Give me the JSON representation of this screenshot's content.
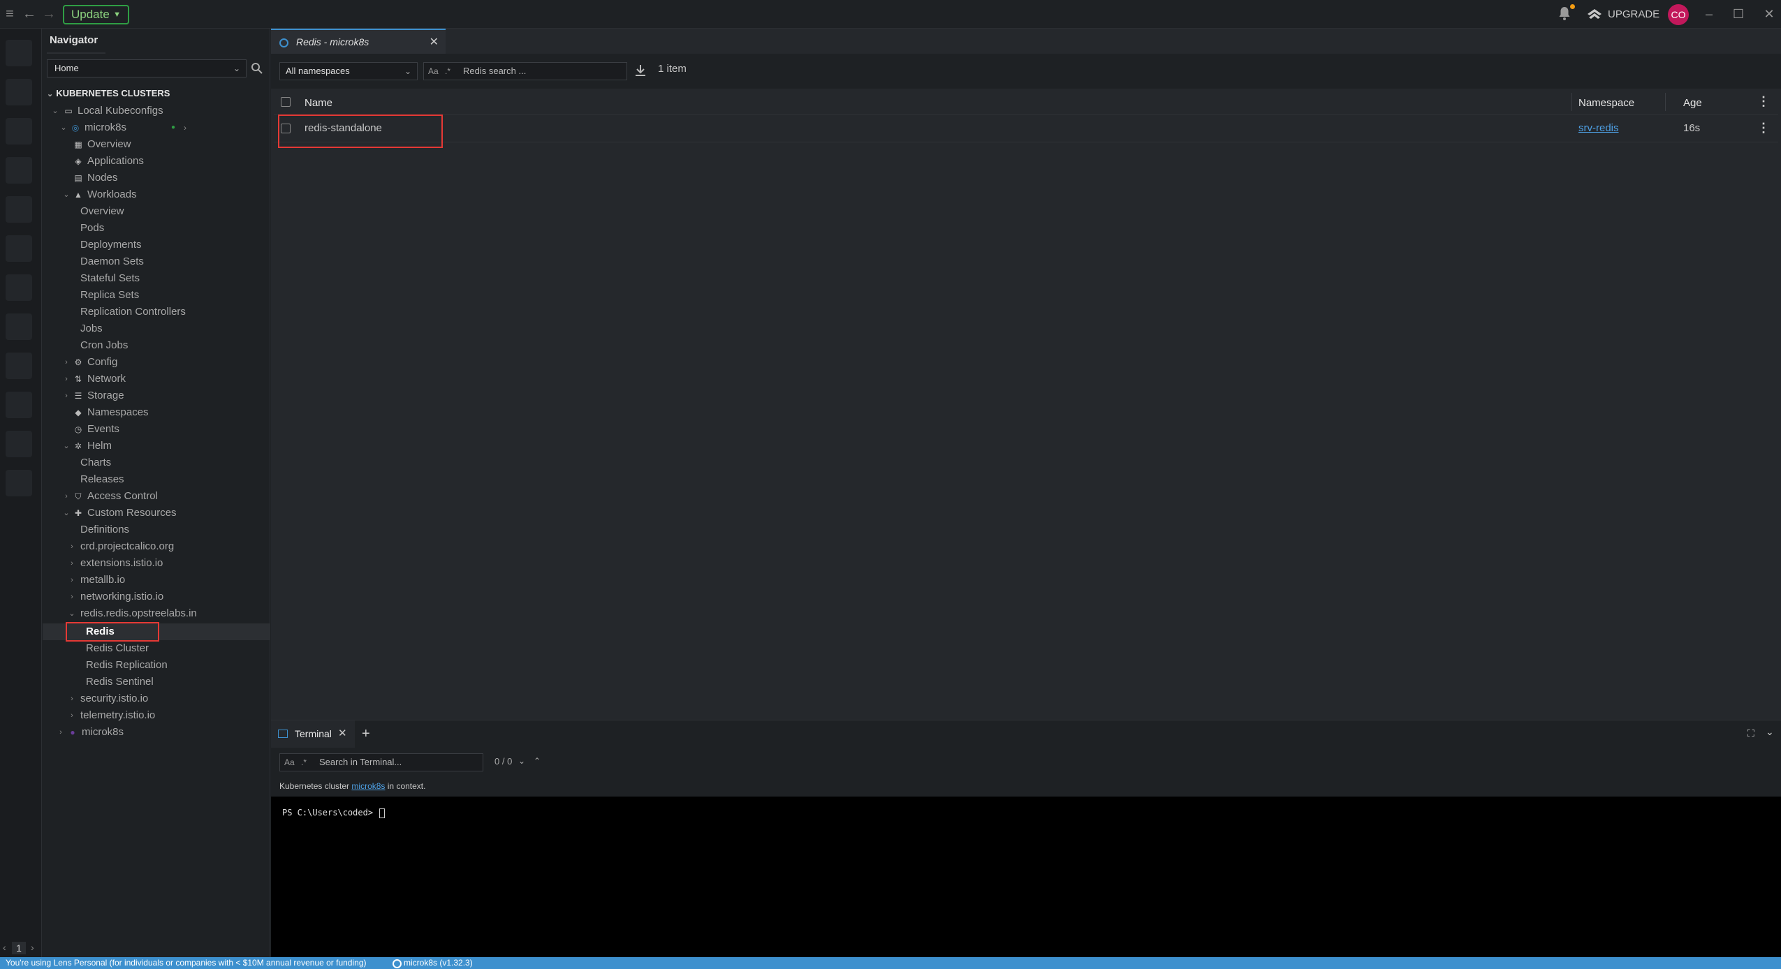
{
  "topbar": {
    "update_label": "Update",
    "upgrade_label": "UPGRADE",
    "avatar_initials": "CO"
  },
  "hotbar": {
    "page": "1"
  },
  "navigator": {
    "title": "Navigator",
    "context_select": "Home",
    "section_header": "KUBERNETES CLUSTERS",
    "items": [
      {
        "label": "Local Kubeconfigs"
      },
      {
        "label": "microk8s"
      },
      {
        "label": "Overview"
      },
      {
        "label": "Applications"
      },
      {
        "label": "Nodes"
      },
      {
        "label": "Workloads"
      },
      {
        "label": "Overview"
      },
      {
        "label": "Pods"
      },
      {
        "label": "Deployments"
      },
      {
        "label": "Daemon Sets"
      },
      {
        "label": "Stateful Sets"
      },
      {
        "label": "Replica Sets"
      },
      {
        "label": "Replication Controllers"
      },
      {
        "label": "Jobs"
      },
      {
        "label": "Cron Jobs"
      },
      {
        "label": "Config"
      },
      {
        "label": "Network"
      },
      {
        "label": "Storage"
      },
      {
        "label": "Namespaces"
      },
      {
        "label": "Events"
      },
      {
        "label": "Helm"
      },
      {
        "label": "Charts"
      },
      {
        "label": "Releases"
      },
      {
        "label": "Access Control"
      },
      {
        "label": "Custom Resources"
      },
      {
        "label": "Definitions"
      },
      {
        "label": "crd.projectcalico.org"
      },
      {
        "label": "extensions.istio.io"
      },
      {
        "label": "metallb.io"
      },
      {
        "label": "networking.istio.io"
      },
      {
        "label": "redis.redis.opstreelabs.in"
      },
      {
        "label": "Redis"
      },
      {
        "label": "Redis Cluster"
      },
      {
        "label": "Redis Replication"
      },
      {
        "label": "Redis Sentinel"
      },
      {
        "label": "security.istio.io"
      },
      {
        "label": "telemetry.istio.io"
      },
      {
        "label": "microk8s"
      }
    ]
  },
  "tab": {
    "title": "Redis - microk8s"
  },
  "toolbar": {
    "namespace_select": "All namespaces",
    "search_aa": "Aa",
    "search_regex": ".*",
    "search_placeholder": "Redis search ...",
    "item_count": "1 item"
  },
  "table": {
    "headers": {
      "name": "Name",
      "namespace": "Namespace",
      "age": "Age"
    },
    "rows": [
      {
        "name": "redis-standalone",
        "namespace": "srv-redis",
        "age": "16s"
      }
    ]
  },
  "terminal": {
    "tab_label": "Terminal",
    "search_aa": "Aa",
    "search_regex": ".*",
    "search_placeholder": "Search in Terminal...",
    "match_count": "0 / 0",
    "context_prefix": "Kubernetes cluster",
    "context_link": "microk8s",
    "context_suffix": "in context.",
    "prompt": "PS C:\\Users\\coded>"
  },
  "statusbar": {
    "license_text": "You're using Lens Personal (for individuals or companies with < $10M annual revenue or funding)",
    "cluster": "microk8s (v1.32.3)"
  },
  "colors": {
    "accent": "#3d90ce",
    "highlight": "#e53935",
    "update_green": "#2f9e44",
    "avatar": "#c2185b",
    "notification_dot": "#f39c12"
  }
}
